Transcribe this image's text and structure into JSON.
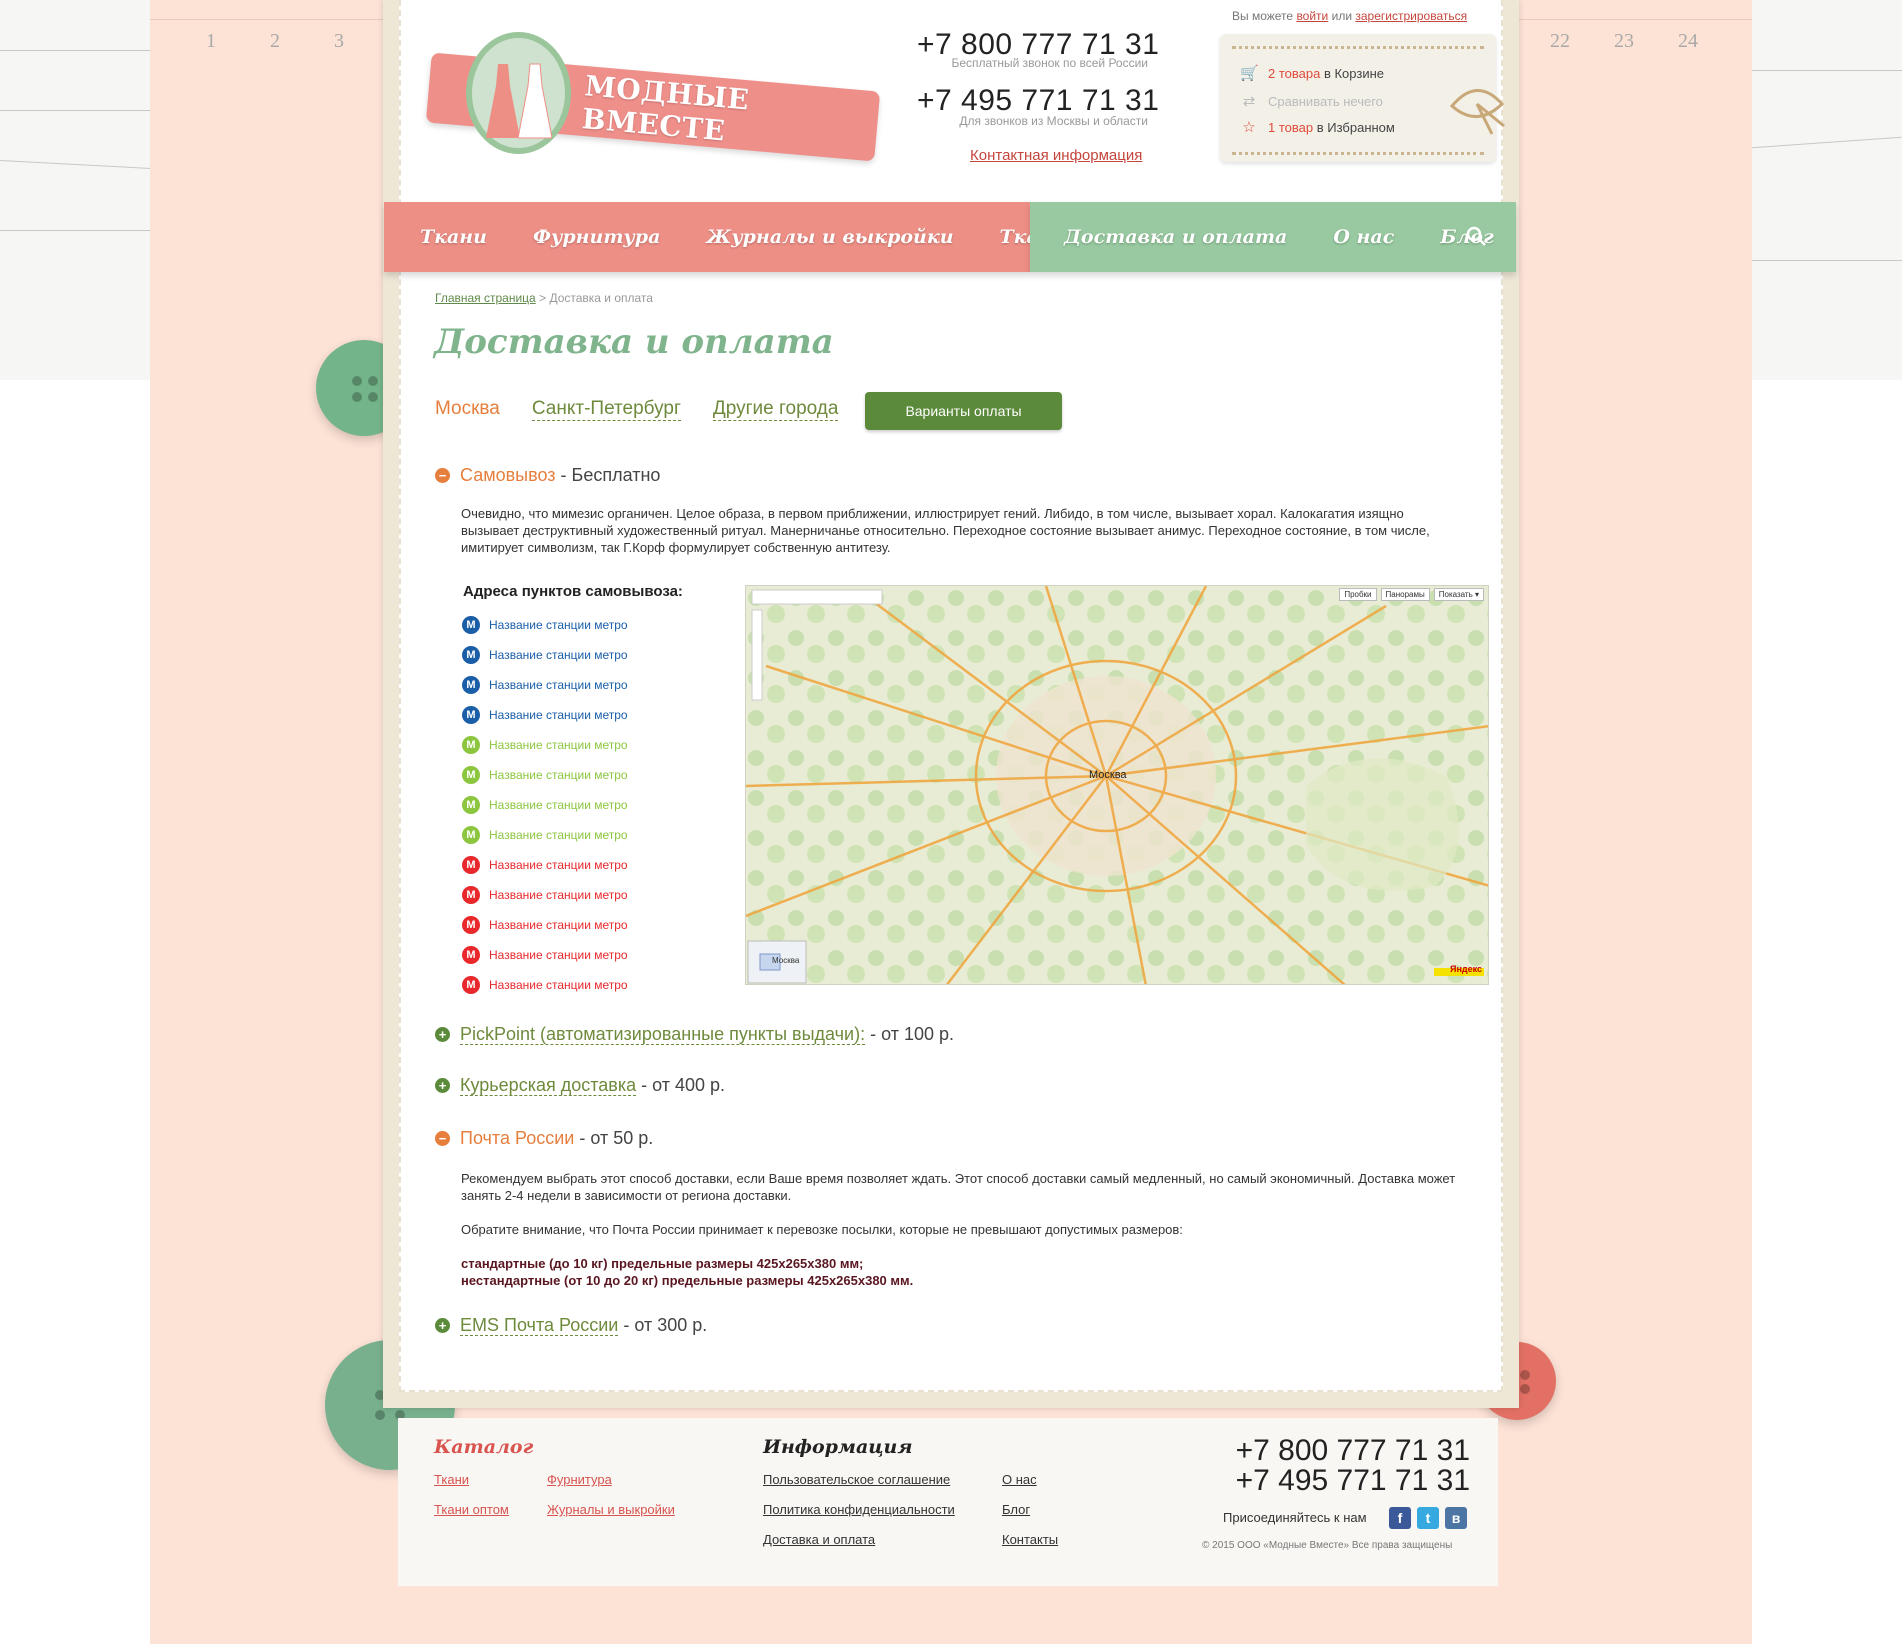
{
  "header": {
    "logo_text": "МОДНЫЕ ВМЕСТЕ",
    "auth": {
      "prefix": "Вы можете",
      "login": "войти",
      "or": "или",
      "register": "зарегистрироваться"
    },
    "phone1": "+7 800 777 71 31",
    "phone1_note": "Бесплатный звонок по всей России",
    "phone2": "+7 495 771 71 31",
    "phone2_note": "Для звонков из Москвы и области",
    "contact_link": "Контактная информация",
    "cart": {
      "cart_count": "2 товара",
      "cart_suffix": "в Корзине",
      "compare": "Сравнивать нечего",
      "fav_count": "1 товар",
      "fav_suffix": "в Избранном"
    }
  },
  "nav": {
    "left": [
      "Ткани",
      "Фурнитура",
      "Журналы и выкройки",
      "Ткани оптом"
    ],
    "right": [
      "Доставка и оплата",
      "О нас",
      "Блог"
    ]
  },
  "breadcrumb": {
    "home": "Главная страница",
    "sep": ">",
    "current": "Доставка и оплата"
  },
  "title": "Доставка и оплата",
  "city_tabs": {
    "active": "Москва",
    "spb": "Санкт-Петербург",
    "other": "Другие города"
  },
  "pay_button": "Варианты оплаты",
  "sections": {
    "pickup": {
      "name": "Самовывоз",
      "price": "- Бесплатно"
    },
    "pickup_text": "Очевидно, что мимезис органичен. Целое образа, в первом приближении, иллюстрирует гений. Либидо, в том числе, вызывает хорал. Калокагатия изящно вызывает деструктивный художественный ритуал. Манерничанье относительно. Переходное состояние вызывает анимус. Переходное состояние, в том числе, имитирует символизм, так Г.Корф формулирует собственную антитезу.",
    "addr_title": "Адреса пунктов самовывоза:",
    "metro_label": "Название станции метро",
    "pickpoint": {
      "name": "PickPoint (автоматизированные пункты выдачи):",
      "price": "- от 100 р."
    },
    "courier": {
      "name": "Курьерская доставка",
      "price": "- от 400 р."
    },
    "post": {
      "name": "Почта России",
      "price": "- от 50 р."
    },
    "post_text1": "Рекомендуем выбрать этот способ доставки, если Ваше время позволяет ждать. Этот способ доставки самый медленный, но самый экономичный. Доставка может занять 2-4 недели в зависимости от региона доставки.",
    "post_text2": "Обратите внимание, что Почта России принимает к перевозке посылки, которые не превышают допустимых размеров:",
    "post_bold1": "стандартные (до 10 кг) предельные размеры 425х265х380 мм;",
    "post_bold2": "нестандартные (от 10 до 20 кг) предельные размеры 425х265х380 мм.",
    "ems": {
      "name": "EMS Почта России",
      "price": "- от 300 р."
    }
  },
  "map": {
    "city": "Москва",
    "buttons": [
      "Пробки",
      "Панорамы",
      "Показать ▾"
    ],
    "brand": "Яндекс",
    "mini_label": "Москва"
  },
  "footer": {
    "catalog_title": "Каталог",
    "catalog_links": [
      "Ткани",
      "Фурнитура",
      "Ткани оптом",
      "Журналы и выкройки"
    ],
    "info_title": "Информация",
    "info_links": [
      "Пользовательское соглашение",
      "О нас",
      "Политика конфиденциальности",
      "Блог",
      "Доставка и оплата",
      "Контакты"
    ],
    "phone1": "+7 800 777 71 31",
    "phone2": "+7 495 771 71 31",
    "join": "Присоединяйтесь к нам",
    "copyright": "© 2015 ООО «Модные Вместе» Все права защищены"
  },
  "colors": {
    "accent_green": "#5b8a3b",
    "accent_orange": "#e67e3c",
    "nav_pink": "#ee8f86",
    "nav_green": "#98c9a0",
    "metro_blue": "#1a5ea8",
    "metro_lime": "#8cc63f",
    "metro_red": "#e8282b"
  }
}
